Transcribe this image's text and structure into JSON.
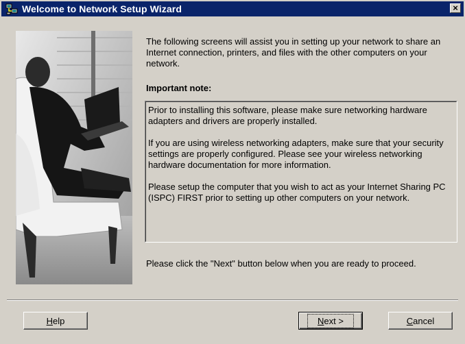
{
  "window": {
    "title": "Welcome to Network Setup Wizard",
    "close_symbol": "×",
    "icon": "network-setup-icon"
  },
  "photo": {
    "icon": "person-with-laptop-photo"
  },
  "intro": {
    "text": "The following screens will assist you in setting up your network to share an Internet connection, printers, and files with the other computers on your network."
  },
  "note": {
    "heading": "Important note:",
    "paragraphs": [
      "Prior to installing this software, please make sure networking hardware adapters and drivers are properly installed.",
      "If you are using wireless networking adapters, make sure that your security settings are properly configured.  Please see your wireless networking hardware documentation for more information.",
      "Please setup the computer that you wish to act as your Internet Sharing PC (ISPC) FIRST prior to setting up other computers on your network."
    ]
  },
  "proceed": {
    "text": "Please click the \"Next\" button below when you are ready to proceed."
  },
  "buttons": {
    "help": {
      "mnemonic": "H",
      "rest": "elp"
    },
    "next": {
      "mnemonic": "N",
      "rest": "ext >"
    },
    "cancel": {
      "mnemonic": "C",
      "rest": "ancel"
    }
  },
  "colors": {
    "title_bar": "#0a246a",
    "dialog_face": "#d4d0c8"
  }
}
